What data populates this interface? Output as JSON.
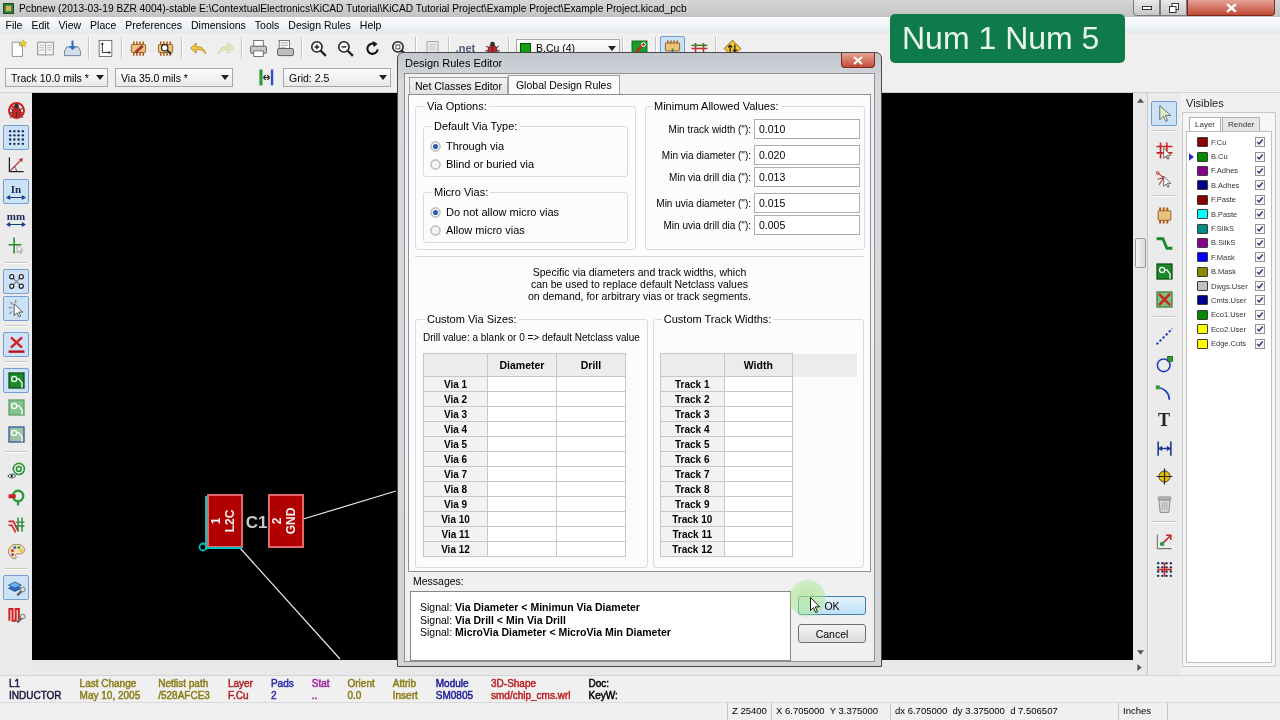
{
  "window": {
    "title": "Pcbnew (2013-03-19 BZR 4004)-stable E:\\ContextualElectronics\\KiCAD Tutorial\\KiCAD Tutorial Project\\Example Project\\Example Project.kicad_pcb"
  },
  "key_overlay": {
    "text": "Num 1 Num 5"
  },
  "menu": [
    "File",
    "Edit",
    "View",
    "Place",
    "Preferences",
    "Dimensions",
    "Tools",
    "Design Rules",
    "Help"
  ],
  "main_toolbar": [
    [
      {
        "kind": "new",
        "on": false
      },
      {
        "kind": "open",
        "on": false
      },
      {
        "kind": "save",
        "on": false
      }
    ],
    [
      {
        "kind": "page_settings",
        "on": false
      }
    ],
    [
      {
        "kind": "footprint_editor",
        "on": false
      },
      {
        "kind": "footprint_viewer",
        "on": false
      }
    ],
    [
      {
        "kind": "undo",
        "on": false
      },
      {
        "kind": "redo",
        "on": false
      }
    ],
    [
      {
        "kind": "print",
        "on": false
      },
      {
        "kind": "plot",
        "on": false
      }
    ],
    [
      {
        "kind": "zoom_in",
        "on": false
      },
      {
        "kind": "zoom_out",
        "on": false
      },
      {
        "kind": "redraw",
        "on": false
      },
      {
        "kind": "zoom_fit",
        "on": false
      }
    ],
    [
      {
        "kind": "find",
        "on": false
      }
    ],
    [
      {
        "kind": "netlist",
        "text": ".net",
        "on": false
      },
      {
        "kind": "drc",
        "on": false
      }
    ],
    [
      {
        "kind": "layer_select",
        "text": "B.Cu (4)"
      }
    ],
    [
      {
        "kind": "layer_pair",
        "on": false
      }
    ],
    [
      {
        "kind": "mode_footprint",
        "on": true
      },
      {
        "kind": "mode_track",
        "on": false
      }
    ],
    [
      {
        "kind": "autoroute",
        "on": false
      }
    ]
  ],
  "options_toolbar": {
    "track_width": "Track 10.0 mils *",
    "via_size": "Via 35.0 mils *",
    "grid": "Grid: 2.5"
  },
  "left_toolbar": [
    [
      {
        "kind": "drc_off",
        "on": false
      },
      {
        "kind": "grid",
        "on": true
      },
      {
        "kind": "polar",
        "on": false
      },
      {
        "kind": "units",
        "text": "In",
        "on": true
      },
      {
        "kind": "units",
        "text": "mm",
        "on": false
      },
      {
        "kind": "cursor",
        "on": false
      }
    ],
    [
      {
        "kind": "ratsnest",
        "on": true
      },
      {
        "kind": "module_ratsnest",
        "on": true
      }
    ],
    [
      {
        "kind": "hide_tracks",
        "on": true
      }
    ],
    [
      {
        "kind": "zone_fill",
        "on": true
      },
      {
        "kind": "zone_outline",
        "on": false
      },
      {
        "kind": "zone_sketch",
        "on": false
      }
    ],
    [
      {
        "kind": "high_contrast",
        "on": false
      },
      {
        "kind": "pads_sketch",
        "on": false
      },
      {
        "kind": "tracks_sketch",
        "on": false
      },
      {
        "kind": "palette",
        "on": false
      }
    ],
    [
      {
        "kind": "layers_manager",
        "on": true
      },
      {
        "kind": "microwave",
        "on": false
      }
    ]
  ],
  "canvas": {
    "footprint": {
      "reference": "C1",
      "pads": [
        {
          "number": "1",
          "net": "L2C"
        },
        {
          "number": "2",
          "net": "GND"
        }
      ]
    }
  },
  "right_toolbar": [
    [
      {
        "kind": "select",
        "on": true
      }
    ],
    [
      {
        "kind": "highlight_net",
        "on": false
      },
      {
        "kind": "local_ratsnest",
        "on": false
      }
    ],
    [
      {
        "kind": "add_footprint",
        "on": false
      },
      {
        "kind": "add_track",
        "on": false
      },
      {
        "kind": "add_zone",
        "on": false
      },
      {
        "kind": "add_keepout",
        "on": false
      }
    ],
    [
      {
        "kind": "add_line",
        "on": false
      },
      {
        "kind": "add_circle",
        "on": false
      },
      {
        "kind": "add_arc",
        "on": false
      },
      {
        "kind": "add_text",
        "text": "T",
        "on": false
      },
      {
        "kind": "add_dimension",
        "on": false
      },
      {
        "kind": "add_target",
        "on": false
      },
      {
        "kind": "delete",
        "on": false
      }
    ],
    [
      {
        "kind": "drill_offset",
        "on": false
      },
      {
        "kind": "grid_origin",
        "on": false
      }
    ]
  ],
  "visibles": {
    "title": "Visibles",
    "tabs": [
      {
        "label": "Layer",
        "selected": true
      },
      {
        "label": "Render",
        "selected": false
      }
    ],
    "layers": [
      {
        "name": "F.Cu",
        "color": "#8b0000",
        "checked": true,
        "selected": false
      },
      {
        "name": "B.Cu",
        "color": "#008b00",
        "checked": true,
        "selected": true
      },
      {
        "name": "F.Adhes",
        "color": "#8b008b",
        "checked": true,
        "selected": false
      },
      {
        "name": "B.Adhes",
        "color": "#00008b",
        "checked": true,
        "selected": false
      },
      {
        "name": "F.Paste",
        "color": "#8b0000",
        "checked": true,
        "selected": false
      },
      {
        "name": "B.Paste",
        "color": "#00ffff",
        "checked": true,
        "selected": false
      },
      {
        "name": "F.SilkS",
        "color": "#008b8b",
        "checked": true,
        "selected": false
      },
      {
        "name": "B.SilkS",
        "color": "#8b008b",
        "checked": true,
        "selected": false
      },
      {
        "name": "F.Mask",
        "color": "#0000ff",
        "checked": true,
        "selected": false
      },
      {
        "name": "B.Mask",
        "color": "#8b8b00",
        "checked": true,
        "selected": false
      },
      {
        "name": "Dwgs.User",
        "color": "#c0c0c0",
        "checked": true,
        "selected": false
      },
      {
        "name": "Cmts.User",
        "color": "#00008b",
        "checked": true,
        "selected": false
      },
      {
        "name": "Eco1.User",
        "color": "#008b00",
        "checked": true,
        "selected": false
      },
      {
        "name": "Eco2.User",
        "color": "#ffff00",
        "checked": true,
        "selected": false
      },
      {
        "name": "Edge.Cuts",
        "color": "#ffff00",
        "checked": true,
        "selected": false
      }
    ]
  },
  "dialog": {
    "title": "Design Rules Editor",
    "tabs": [
      {
        "label": "Net Classes Editor",
        "selected": false
      },
      {
        "label": "Global Design Rules",
        "selected": true
      }
    ],
    "via_options": {
      "title": "Via Options:",
      "groups": [
        {
          "title": "Default Via Type:",
          "options": [
            {
              "label": "Through via",
              "selected": true
            },
            {
              "label": "Blind or buried via",
              "selected": false
            }
          ]
        },
        {
          "title": "Micro Vias:",
          "options": [
            {
              "label": "Do not allow micro vias",
              "selected": true
            },
            {
              "label": "Allow micro vias",
              "selected": false
            }
          ]
        }
      ]
    },
    "min_values": {
      "title": "Minimum Allowed Values:",
      "groups": [
        [
          {
            "label": "Min track width (\"):",
            "value": "0.010"
          }
        ],
        [
          {
            "label": "Min via diameter (\"):",
            "value": "0.020"
          },
          {
            "label": "Min via drill dia (\"):",
            "value": "0.013"
          }
        ],
        [
          {
            "label": "Min uvia diameter (\"):",
            "value": "0.015"
          },
          {
            "label": "Min uvia drill dia (\"):",
            "value": "0.005"
          }
        ]
      ]
    },
    "description": "Specific via diameters and track widths, which\ncan be used to replace default Netclass values\non demand, for arbitrary vias or track segments.",
    "via_sizes": {
      "title": "Custom Via Sizes:",
      "note": "Drill value: a blank or 0 => default Netclass value",
      "columns": [
        "Diameter",
        "Drill"
      ],
      "rows": [
        "Via 1",
        "Via 2",
        "Via 3",
        "Via 4",
        "Via 5",
        "Via 6",
        "Via 7",
        "Via 8",
        "Via 9",
        "Via 10",
        "Via 11",
        "Via 12"
      ]
    },
    "track_widths": {
      "title": "Custom Track Widths:",
      "columns": [
        "Width"
      ],
      "rows": [
        "Track 1",
        "Track 2",
        "Track 3",
        "Track 4",
        "Track 5",
        "Track 6",
        "Track 7",
        "Track 8",
        "Track 9",
        "Track 10",
        "Track 11",
        "Track 12"
      ]
    },
    "messages": {
      "title": "Messages:",
      "lines": [
        "Signal: **Via Diameter < Minimun Via Diameter**",
        "Signal: **Via Drill < Min Via Drill**",
        "Signal: **MicroVia Diameter < MicroVia Min Diameter**"
      ]
    },
    "buttons": [
      {
        "label": "OK",
        "focused": true
      },
      {
        "label": "Cancel",
        "focused": false
      }
    ]
  },
  "status_bar": {
    "fields": [
      {
        "lines": [
          "L1",
          "INDUCTOR"
        ],
        "color": "#1a1a40"
      },
      {
        "lines": [
          "Last Change",
          "May 10, 2005"
        ],
        "color": "#8b7b16"
      },
      {
        "lines": [
          "Netlist path",
          "/528AFCE3"
        ],
        "color": "#8b7b16"
      },
      {
        "lines": [
          "Layer",
          "F.Cu"
        ],
        "color": "#b22222"
      },
      {
        "lines": [
          "Pads",
          "2"
        ],
        "color": "#2a2ab0"
      },
      {
        "lines": [
          "Stat",
          ".."
        ],
        "color": "#a020a0"
      },
      {
        "lines": [
          "Orient",
          "0.0"
        ],
        "color": "#8b7b16"
      },
      {
        "lines": [
          "Attrib",
          "Insert"
        ],
        "color": "#8b7b16"
      },
      {
        "lines": [
          "Module",
          "SM0805"
        ],
        "color": "#1a1a9a"
      },
      {
        "lines": [
          "3D-Shape",
          "smd/chip_cms.wrl"
        ],
        "color": "#c02020"
      },
      {
        "lines": [
          "Doc:",
          "KeyW:"
        ],
        "color": "#000000"
      }
    ],
    "coordinates": [
      "Z 25400",
      "X 6.705000  Y 3.375000",
      "dx 6.705000  dy 3.375000  d 7.506507",
      "Inches"
    ]
  }
}
